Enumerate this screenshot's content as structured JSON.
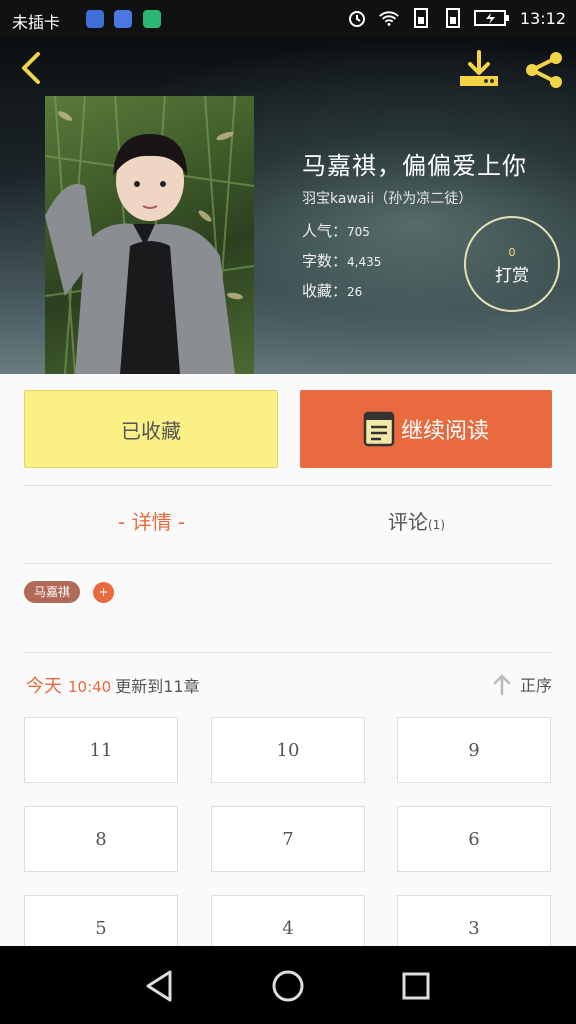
{
  "status_bar": {
    "carrier": "未插卡",
    "time": "13:12"
  },
  "book": {
    "title": "马嘉祺，偏偏爱上你",
    "author": "羽宝kawaii（孙为凉二徒）",
    "popularity_label": "人气：",
    "popularity_value": "705",
    "word_count_label": "字数：",
    "word_count_value": "4,435",
    "favorites_label": "收藏：",
    "favorites_value": "26"
  },
  "reward": {
    "count": "0",
    "label": "打赏"
  },
  "actions": {
    "collected_label": "已收藏",
    "continue_label": "继续阅读"
  },
  "tabs": {
    "detail_label": "- 详情 -",
    "comments_label": "评论",
    "comments_count": "(1)"
  },
  "tags": {
    "items": [
      "马嘉祺"
    ],
    "add_label": "+"
  },
  "update": {
    "today": "今天",
    "time": "10:40",
    "message": "更新到11章",
    "sort_label": "正序"
  },
  "chapters": [
    "11",
    "10",
    "9",
    "8",
    "7",
    "6",
    "5",
    "4",
    "3"
  ],
  "colors": {
    "accent": "#e96a3f",
    "collected_bg": "#fbf086",
    "tag_bg": "#b06a55",
    "reward_border": "#e7dfb6"
  },
  "icons": [
    "back-arrow-icon",
    "download-icon",
    "share-icon",
    "book-icon",
    "sort-up-icon",
    "nav-back-icon",
    "nav-home-icon",
    "nav-recents-icon"
  ]
}
